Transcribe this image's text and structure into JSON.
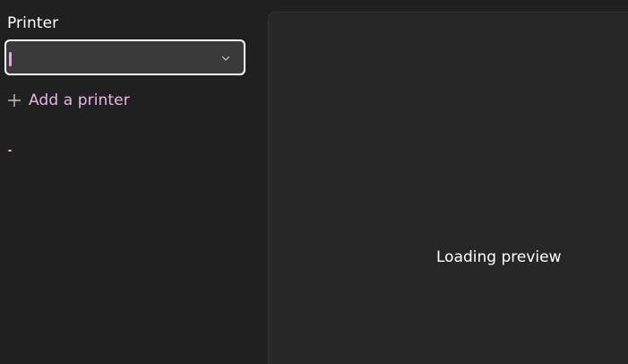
{
  "printer": {
    "label": "Printer",
    "selected_value": ""
  },
  "add_printer": {
    "label": "Add a printer"
  },
  "preview": {
    "status_text": "Loading preview"
  },
  "colors": {
    "accent": "#e6a3e6",
    "link": "#e8b6e8",
    "background": "#202020",
    "preview_background": "#272727"
  },
  "icons": {
    "dropdown": "chevron-down-icon",
    "add": "plus-icon"
  }
}
